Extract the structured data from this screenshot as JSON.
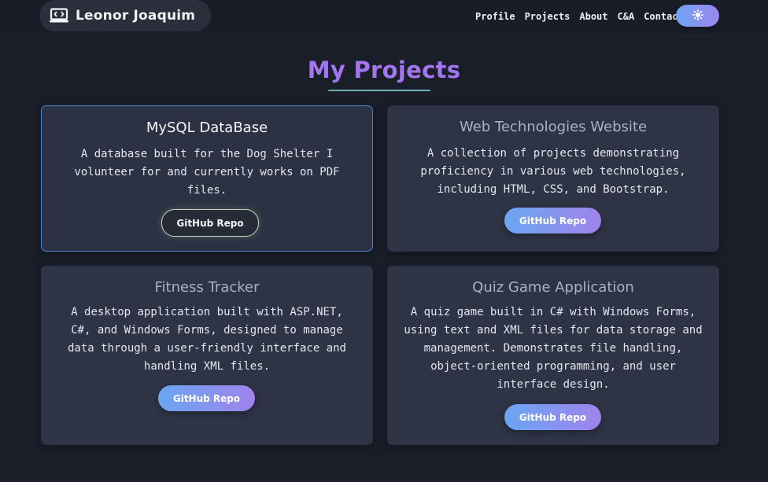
{
  "header": {
    "brand_icon": "laptop-code-icon",
    "brand_name": "Leonor Joaquim",
    "nav": [
      "Profile",
      "Projects",
      "About",
      "C&A",
      "Contact"
    ],
    "theme_icon": "sun-icon"
  },
  "main": {
    "title": "My Projects",
    "projects": [
      {
        "title": "MySQL DataBase",
        "description": "A database built for the Dog Shelter I volunteer for and currently works on PDF files.",
        "button": "GitHub Repo"
      },
      {
        "title": "Web Technologies Website",
        "description": "A collection of projects demonstrating proficiency in various web technologies, including HTML, CSS, and Bootstrap.",
        "button": "GitHub Repo"
      },
      {
        "title": "Fitness Tracker",
        "description": "A desktop application built with ASP.NET, C#, and Windows Forms, designed to manage data through a user-friendly interface and handling XML files.",
        "button": "GitHub Repo"
      },
      {
        "title": "Quiz Game Application",
        "description": "A quiz game built in C# with Windows Forms, using text and XML files for data storage and management. Demonstrates file handling, object-oriented programming, and user interface design.",
        "button": "GitHub Repo"
      }
    ]
  },
  "colors": {
    "background": "#1a1e29",
    "card": "#2e3445",
    "title": "#a277ee",
    "gradient_start": "#6aa6f3",
    "gradient_end": "#a083ec"
  }
}
